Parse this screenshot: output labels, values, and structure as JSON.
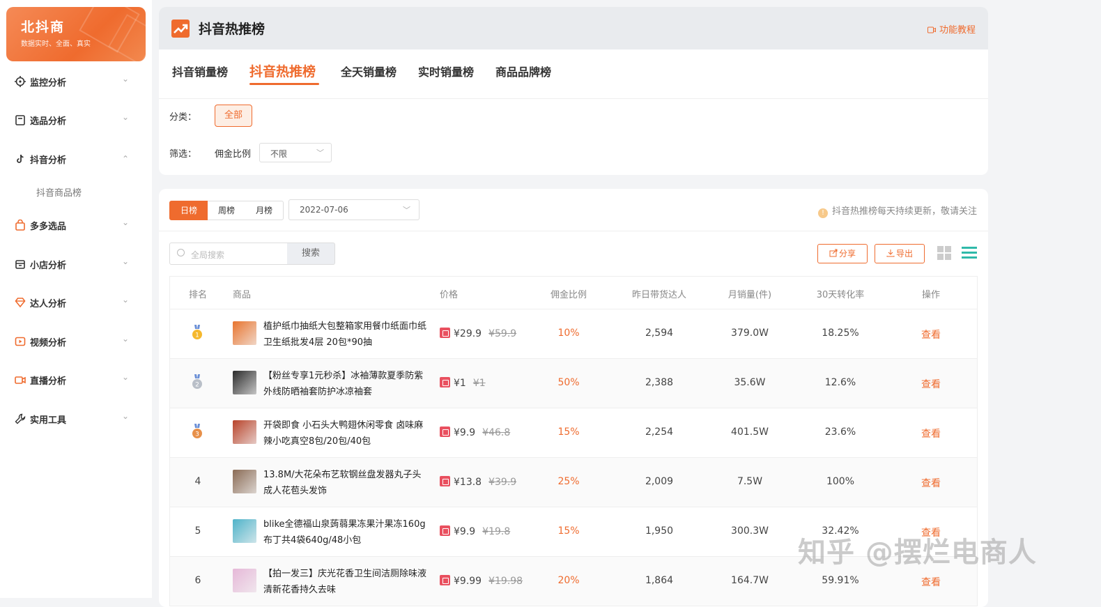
{
  "brand": {
    "name": "北抖商",
    "slogan": "数据实时、全面、真实"
  },
  "sidebar": {
    "items": [
      {
        "label": "监控分析",
        "icon": "crosshair-icon",
        "chevron": "⌄"
      },
      {
        "label": "选品分析",
        "icon": "clipboard-icon",
        "chevron": "⌄"
      },
      {
        "label": "抖音分析",
        "icon": "tiktok-icon",
        "chevron": "⌃"
      },
      {
        "label": "多多选品",
        "icon": "bag-icon",
        "chevron": "⌄"
      },
      {
        "label": "小店分析",
        "icon": "store-icon",
        "chevron": "⌄"
      },
      {
        "label": "达人分析",
        "icon": "diamond-icon",
        "chevron": "⌄"
      },
      {
        "label": "视频分析",
        "icon": "play-icon",
        "chevron": "⌄"
      },
      {
        "label": "直播分析",
        "icon": "camera-icon",
        "chevron": "⌄"
      },
      {
        "label": "实用工具",
        "icon": "wrench-icon",
        "chevron": "⌄"
      }
    ],
    "subitem": "抖音商品榜"
  },
  "header": {
    "title": "抖音热推榜",
    "tutorial": "功能教程"
  },
  "tabs": [
    "抖音销量榜",
    "抖音热推榜",
    "全天销量榜",
    "实时销量榜",
    "商品品牌榜"
  ],
  "active_tab": "抖音热推榜",
  "filters": {
    "category_label": "分类：",
    "category_value": "全部",
    "filter_label": "筛选：",
    "commission_label": "佣金比例",
    "commission_value": "不限"
  },
  "toolbar": {
    "periods": [
      "日榜",
      "周榜",
      "月榜"
    ],
    "active_period": "日榜",
    "date": "2022-07-06",
    "notice": "抖音热推榜每天持续更新，敬请关注",
    "search_placeholder": "全局搜索",
    "search_button": "搜索",
    "share_label": "分享",
    "export_label": "导出"
  },
  "table": {
    "columns": [
      "排名",
      "商品",
      "价格",
      "佣金比例",
      "昨日带货达人",
      "月销量(件)",
      "30天转化率",
      "操作"
    ],
    "rows": [
      {
        "rank": "1",
        "name": "植护纸巾抽纸大包整箱家用餐巾纸面巾纸卫生纸批发4层 20包*90抽",
        "price": "¥29.9",
        "old_price": "¥59.9",
        "commission": "10%",
        "kol": "2,594",
        "monthly": "379.0W",
        "conversion": "18.25%",
        "action": "查看",
        "img_color": "#e8742e"
      },
      {
        "rank": "2",
        "name": "【粉丝专享1元秒杀】冰袖薄款夏季防紫外线防晒袖套防护冰凉袖套",
        "price": "¥1",
        "old_price": "¥1",
        "commission": "50%",
        "kol": "2,388",
        "monthly": "35.6W",
        "conversion": "12.6%",
        "action": "查看",
        "img_color": "#2b2b2b"
      },
      {
        "rank": "3",
        "name": "开袋即食 小石头大鸭翅休闲零食 卤味麻辣小吃真空8包/20包/40包",
        "price": "¥9.9",
        "old_price": "¥46.8",
        "commission": "15%",
        "kol": "2,254",
        "monthly": "401.5W",
        "conversion": "23.6%",
        "action": "查看",
        "img_color": "#b8432a"
      },
      {
        "rank": "4",
        "name": "13.8M/大花朵布艺软钢丝盘发器丸子头成人花苞头发饰",
        "price": "¥13.8",
        "old_price": "¥39.9",
        "commission": "25%",
        "kol": "2,009",
        "monthly": "7.5W",
        "conversion": "100%",
        "action": "查看",
        "img_color": "#8a6b55"
      },
      {
        "rank": "5",
        "name": "blike全德福山泉蒟蒻果冻果汁果冻160g布丁共4袋640g/48小包",
        "price": "¥9.9",
        "old_price": "¥19.8",
        "commission": "15%",
        "kol": "1,950",
        "monthly": "300.3W",
        "conversion": "32.42%",
        "action": "查看",
        "img_color": "#4fb3c9"
      },
      {
        "rank": "6",
        "name": "【拍一发三】庆光花香卫生间洁厕除味液清新花香持久去味",
        "price": "¥9.99",
        "old_price": "¥19.98",
        "commission": "20%",
        "kol": "1,864",
        "monthly": "164.7W",
        "conversion": "59.91%",
        "action": "查看",
        "img_color": "#e6b8d8"
      }
    ]
  },
  "watermark": "知乎 @摆烂电商人"
}
